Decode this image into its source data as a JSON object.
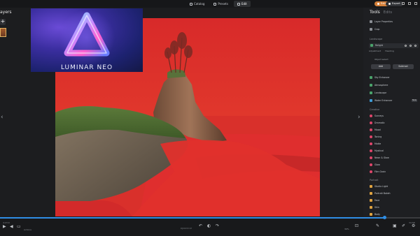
{
  "topbar": {
    "tabs": [
      {
        "label": "Catalog",
        "active": false
      },
      {
        "label": "Presets",
        "active": false
      },
      {
        "label": "Edit",
        "active": true
      }
    ],
    "extra_label": "Extras",
    "export_label": "Export"
  },
  "left": {
    "layers_title": "ayers",
    "add_label": "+"
  },
  "logo": {
    "text": "LUMINAR NEO"
  },
  "panel": {
    "tab_tools": "Tools",
    "tab_edits": "Edits",
    "rows": [
      {
        "label": "Layer Properties",
        "color": "#8b8f95"
      },
      {
        "label": "Crop",
        "color": "#8b8f95"
      }
    ],
    "section_landscape": "Landscape",
    "active_tool": "Relight",
    "adjustment_label": "Adjustment",
    "adjustment_value": "Heading",
    "object_label": "Object select",
    "add_button": "Add",
    "subtract_button": "Subtract",
    "landscape_items": [
      {
        "label": "Sky Enhancer",
        "color": "#4aa36b"
      },
      {
        "label": "Atmosphere",
        "color": "#4aa36b"
      },
      {
        "label": "Landscape",
        "color": "#4aa36b"
      },
      {
        "label": "Water Enhancer",
        "color": "#3e9bd6"
      }
    ],
    "section_creative": "Creative",
    "creative_items": [
      {
        "label": "Sunrays",
        "color": "#e0466b"
      },
      {
        "label": "Dramatic",
        "color": "#e0466b"
      },
      {
        "label": "Mood",
        "color": "#e0466b"
      },
      {
        "label": "Toning",
        "color": "#e0466b"
      },
      {
        "label": "Matte",
        "color": "#e0466b"
      },
      {
        "label": "Mystical",
        "color": "#e0466b"
      },
      {
        "label": "Neon & Glow",
        "color": "#e0466b"
      },
      {
        "label": "Glow",
        "color": "#e0466b"
      },
      {
        "label": "Film Grain",
        "color": "#e0466b"
      }
    ],
    "section_portrait": "Portrait",
    "portrait_items": [
      {
        "label": "Studio Light",
        "color": "#e0a340"
      },
      {
        "label": "Portrait Bokeh",
        "color": "#e0a340"
      },
      {
        "label": "Face",
        "color": "#e0a340"
      },
      {
        "label": "Skin",
        "color": "#e0a340"
      },
      {
        "label": "Body",
        "color": "#e0a340"
      },
      {
        "label": "High Key",
        "color": "#e0a340"
      }
    ],
    "new_badge": "New"
  },
  "bottom": {
    "time_left": "4:23:9",
    "time_right": "34:58",
    "filename": "DJI0033.tif",
    "zoom": "30%",
    "left_text": "Actions"
  },
  "colors": {
    "accent": "#2f8de4",
    "mask_red": "#e02a2a",
    "extras": "#d4803a"
  }
}
